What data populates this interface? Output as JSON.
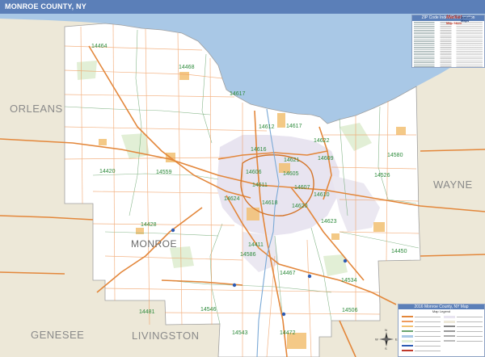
{
  "title": "MONROE COUNTY, NY",
  "colors": {
    "title_bar": "#5b7fb8",
    "water": "#a9c8e6",
    "outside_land": "#ede8d8",
    "county_land": "#ffffff",
    "urban": "#e8e4f0",
    "park": "#e2efd6",
    "highway": "#e3873b",
    "road": "#ef9a5c",
    "zip_boundary": "#6aa56e",
    "zip_label": "#2e8b3c"
  },
  "counties": [
    {
      "name": "ORLEANS"
    },
    {
      "name": "WAYNE"
    },
    {
      "name": "GENESEE"
    },
    {
      "name": "LIVINGSTON"
    },
    {
      "name": "MONROE"
    }
  ],
  "zip_labels": [
    {
      "code": "14464"
    },
    {
      "code": "14468"
    },
    {
      "code": "14617"
    },
    {
      "code": "14612"
    },
    {
      "code": "14617"
    },
    {
      "code": "14622"
    },
    {
      "code": "14580"
    },
    {
      "code": "14616"
    },
    {
      "code": "14621"
    },
    {
      "code": "14609"
    },
    {
      "code": "14526"
    },
    {
      "code": "14420"
    },
    {
      "code": "14559"
    },
    {
      "code": "14606"
    },
    {
      "code": "14605"
    },
    {
      "code": "14611"
    },
    {
      "code": "14607"
    },
    {
      "code": "14624"
    },
    {
      "code": "14610"
    },
    {
      "code": "14620"
    },
    {
      "code": "14618"
    },
    {
      "code": "14428"
    },
    {
      "code": "14623"
    },
    {
      "code": "14450"
    },
    {
      "code": "14586"
    },
    {
      "code": "14467"
    },
    {
      "code": "14534"
    },
    {
      "code": "14546"
    },
    {
      "code": "14506"
    },
    {
      "code": "14543"
    },
    {
      "code": "14472"
    },
    {
      "code": "14481"
    },
    {
      "code": "14411"
    }
  ],
  "zip_index": {
    "header": "ZIP Code Index/Grid Location",
    "row_count": 27
  },
  "legend": {
    "header": "2016 Monroe County, NY Map",
    "subheader": "Map Legend"
  },
  "logo": {
    "brand": "Market",
    "sub": "Market Maps",
    "tag": "Map Store"
  },
  "compass": {
    "north": "N",
    "south": "S",
    "east": "E",
    "west": "W"
  }
}
